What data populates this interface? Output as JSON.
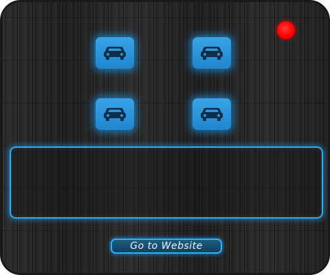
{
  "tiles": [
    {
      "icon": "car-icon"
    },
    {
      "icon": "car-icon"
    },
    {
      "icon": "car-icon"
    },
    {
      "icon": "car-icon"
    }
  ],
  "indicator": {
    "color": "#ff0000"
  },
  "colors": {
    "accent": "#33aaf0",
    "tile": "#2b95dc",
    "background": "#232323"
  },
  "display": {
    "text": ""
  },
  "website_button": {
    "label": "Go to Website"
  }
}
